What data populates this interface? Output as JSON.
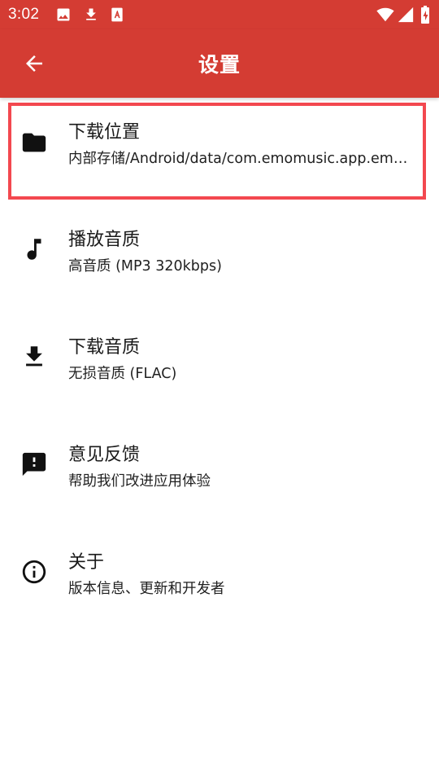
{
  "status_bar": {
    "time": "3:02",
    "left_icons": [
      "image-icon",
      "download-icon",
      "text-recognition-icon"
    ],
    "right_icons": [
      "wifi-icon",
      "signal-icon",
      "battery-charging-icon"
    ]
  },
  "app_bar": {
    "title": "设置",
    "back_icon": "arrow-left-icon",
    "background_color": "#d43c33"
  },
  "settings": [
    {
      "icon": "folder-icon",
      "title": "下载位置",
      "subtitle": "内部存储/Android/data/com.emomusic.app.emo…",
      "highlighted": true
    },
    {
      "icon": "music-note-icon",
      "title": "播放音质",
      "subtitle": "高音质 (MP3 320kbps)"
    },
    {
      "icon": "download-icon",
      "title": "下载音质",
      "subtitle": "无损音质 (FLAC)"
    },
    {
      "icon": "feedback-icon",
      "title": "意见反馈",
      "subtitle": "帮助我们改进应用体验"
    },
    {
      "icon": "info-icon",
      "title": "关于",
      "subtitle": "版本信息、更新和开发者"
    }
  ],
  "highlight_color": "#f3484f"
}
